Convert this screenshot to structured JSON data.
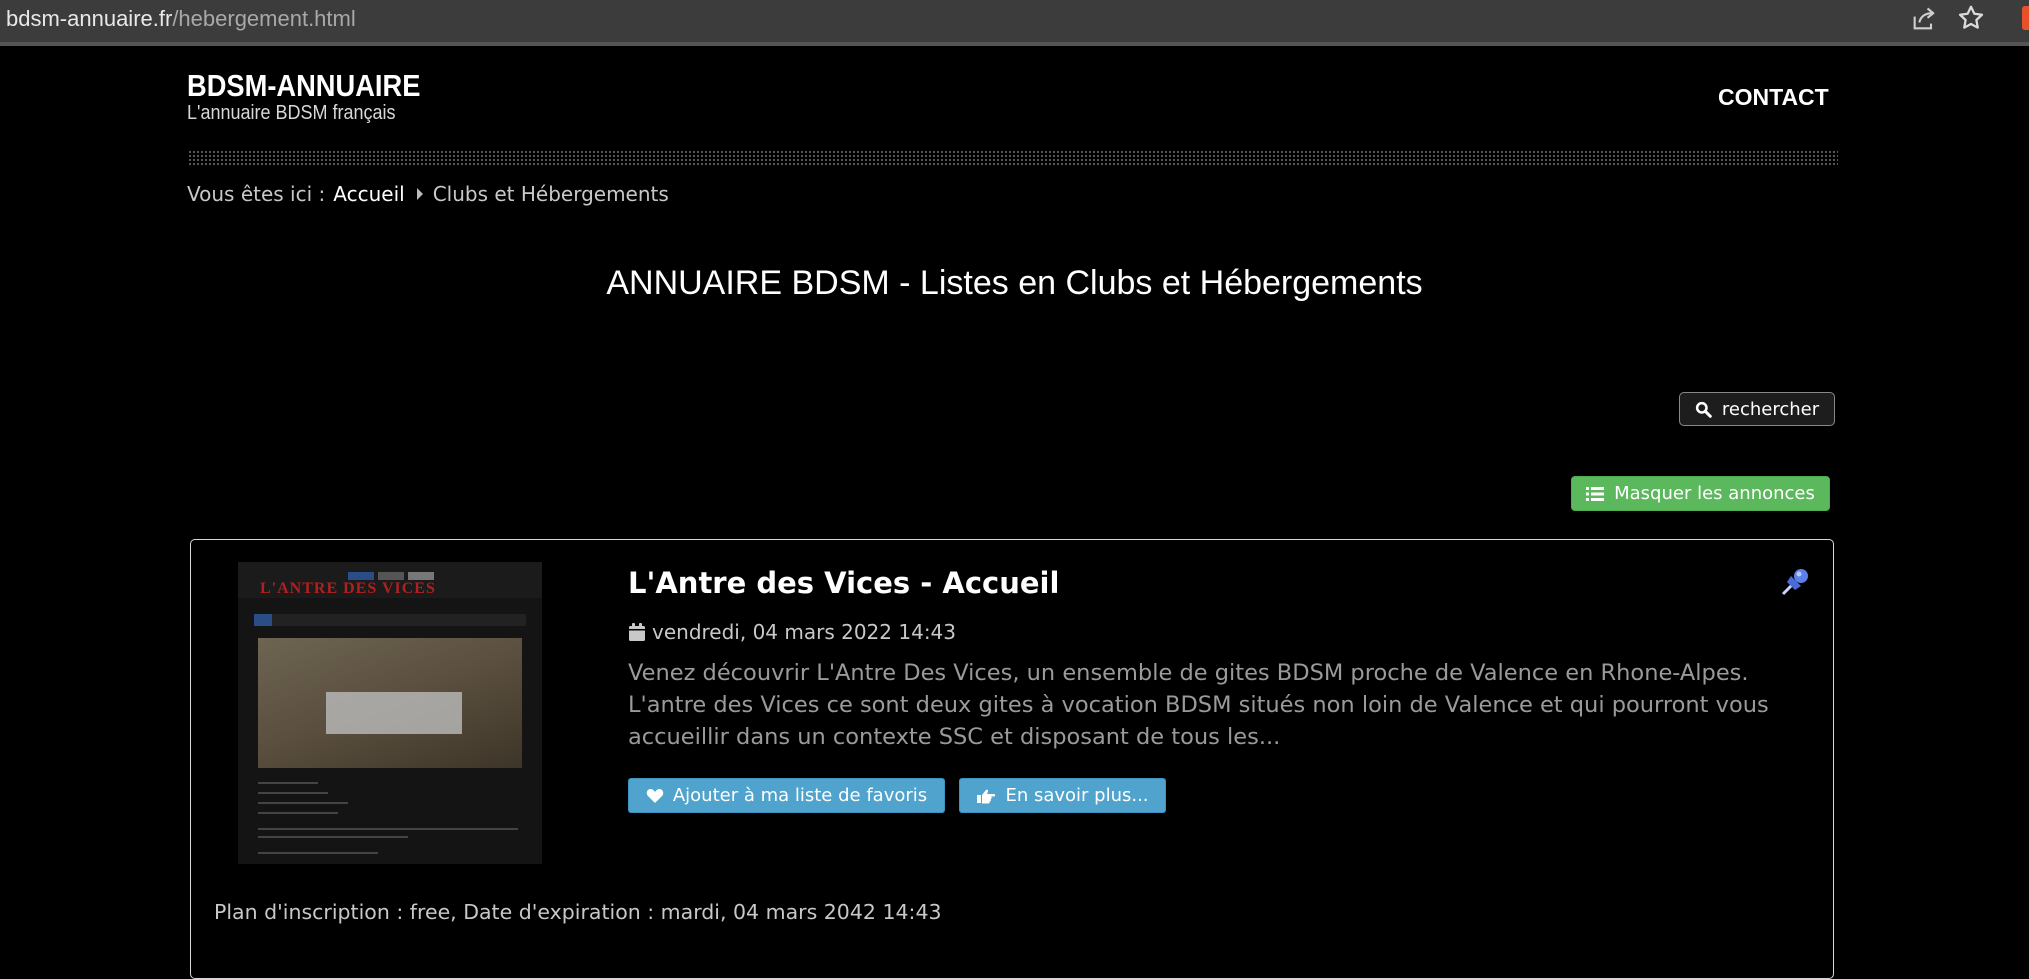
{
  "browser": {
    "url_domain": "bdsm-annuaire.fr",
    "url_path": "/hebergement.html"
  },
  "header": {
    "site_title": "BDSM-ANNUAIRE",
    "site_subtitle": "L'annuaire BDSM français",
    "nav_contact": "CONTACT"
  },
  "breadcrumb": {
    "prefix": "Vous êtes ici :",
    "home": "Accueil",
    "current": "Clubs et Hébergements"
  },
  "page_heading": "ANNUAIRE BDSM - Listes en Clubs et Hébergements",
  "actions": {
    "search_label": "rechercher",
    "hide_ads_label": "Masquer les annonces"
  },
  "listing": {
    "title": "L'Antre des Vices - Accueil",
    "date": "vendredi, 04 mars 2022 14:43",
    "description": "Venez découvrir L'Antre Des Vices, un ensemble de gites BDSM proche de Valence en Rhone-Alpes. L'antre des Vices ce sont deux gites à vocation BDSM situés non loin de Valence et qui pourront vous accueillir dans un contexte SSC et disposant de tous les...",
    "favorite_label": "Ajouter à ma liste de favoris",
    "more_label": "En savoir plus...",
    "plan_info": "Plan d'inscription : free, Date d'expiration : mardi, 04 mars 2042 14:43",
    "thumbnail_logo": "L'ANTRE DES VICES"
  },
  "colors": {
    "background": "#000000",
    "hide_button": "#5cb85c",
    "action_button": "#4fa3cc",
    "description_text": "#9a9a9a"
  },
  "icons": [
    "share-icon",
    "star-icon",
    "search-icon",
    "list-icon",
    "pin-icon",
    "calendar-icon",
    "heart-icon",
    "hand-pointer-icon"
  ]
}
